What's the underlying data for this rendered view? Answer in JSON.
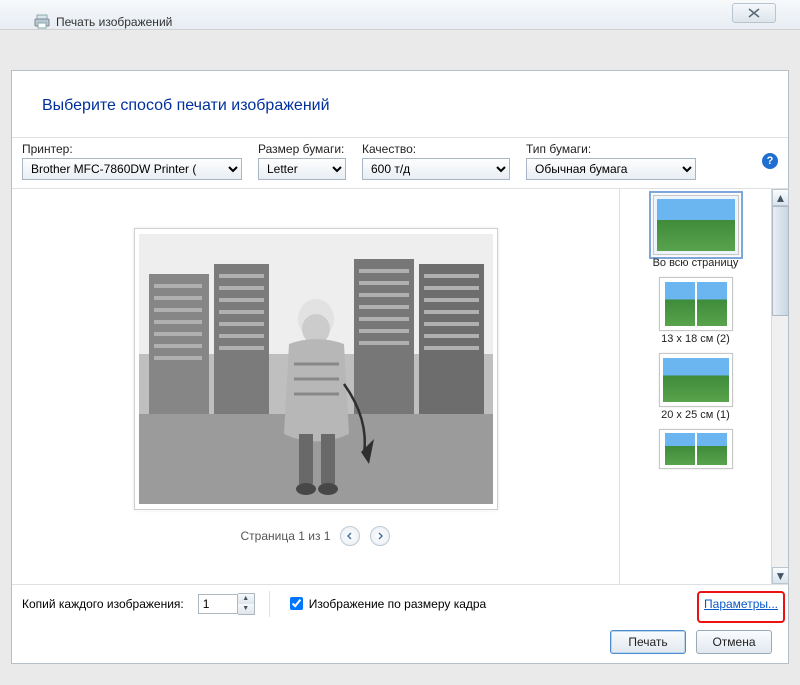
{
  "title": "Печать изображений",
  "header": "Выберите способ печати изображений",
  "labels": {
    "printer": "Принтер:",
    "paper_size": "Размер бумаги:",
    "quality": "Качество:",
    "paper_type": "Тип бумаги:"
  },
  "combos": {
    "printer": "Brother MFC-7860DW Printer ( ",
    "paper_size": "Letter",
    "quality": "600 т/д",
    "paper_type": "Обычная бумага"
  },
  "paging": "Страница 1 из 1",
  "layouts": {
    "full": "Во всю страницу",
    "l1318": "13 x 18 см (2)",
    "l2025": "20 x 25 см (1)"
  },
  "footer": {
    "copies_label": "Копий каждого изображения:",
    "copies_value": "1",
    "fit_label": "Изображение по размеру кадра",
    "params": "Параметры..."
  },
  "buttons": {
    "print": "Печать",
    "cancel": "Отмена"
  }
}
